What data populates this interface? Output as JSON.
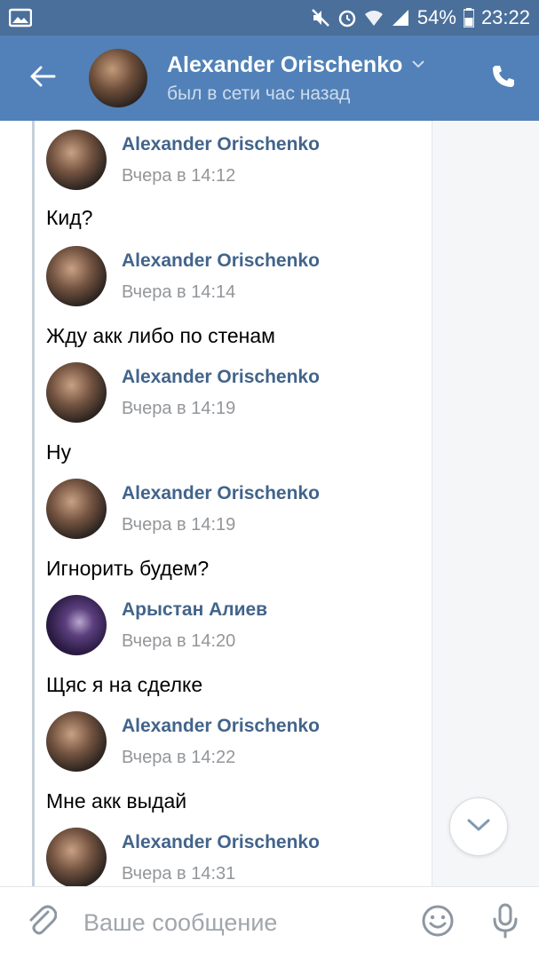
{
  "statusbar": {
    "battery": "54%",
    "time": "23:22"
  },
  "header": {
    "name": "Alexander Orischenko",
    "status": "был в сети час назад"
  },
  "messages": [
    {
      "author": "Alexander Orischenko",
      "time": "Вчера в 14:12",
      "text": ""
    },
    {
      "author": "",
      "time": "",
      "text": "Кид?"
    },
    {
      "author": "Alexander Orischenko",
      "time": "Вчера в 14:14",
      "text": "Жду акк либо по стенам"
    },
    {
      "author": "Alexander Orischenko",
      "time": "Вчера в 14:19",
      "text": "Ну"
    },
    {
      "author": "Alexander Orischenko",
      "time": "Вчера в 14:19",
      "text": "Игнорить будем?"
    },
    {
      "author": "Арыстан Алиев",
      "time": "Вчера в 14:20",
      "text": "Щяс я на сделке"
    },
    {
      "author": "Alexander Orischenko",
      "time": "Вчера в 14:22",
      "text": "Мне акк выдай"
    },
    {
      "author": "Alexander Orischenko",
      "time": "Вчера в 14:31",
      "text": ""
    }
  ],
  "composer": {
    "placeholder": "Ваше сообщение"
  },
  "colors": {
    "header_bg": "#5181b8",
    "statusbar_bg": "#4a6f9b",
    "author_link": "#42648b",
    "time_gray": "#939699"
  },
  "icons": [
    "image-icon",
    "mute-icon",
    "alarm-icon",
    "wifi-icon",
    "signal-icon",
    "battery-icon",
    "back-arrow-icon",
    "chevron-down-icon",
    "phone-icon",
    "paperclip-icon",
    "emoji-icon",
    "mic-icon"
  ]
}
